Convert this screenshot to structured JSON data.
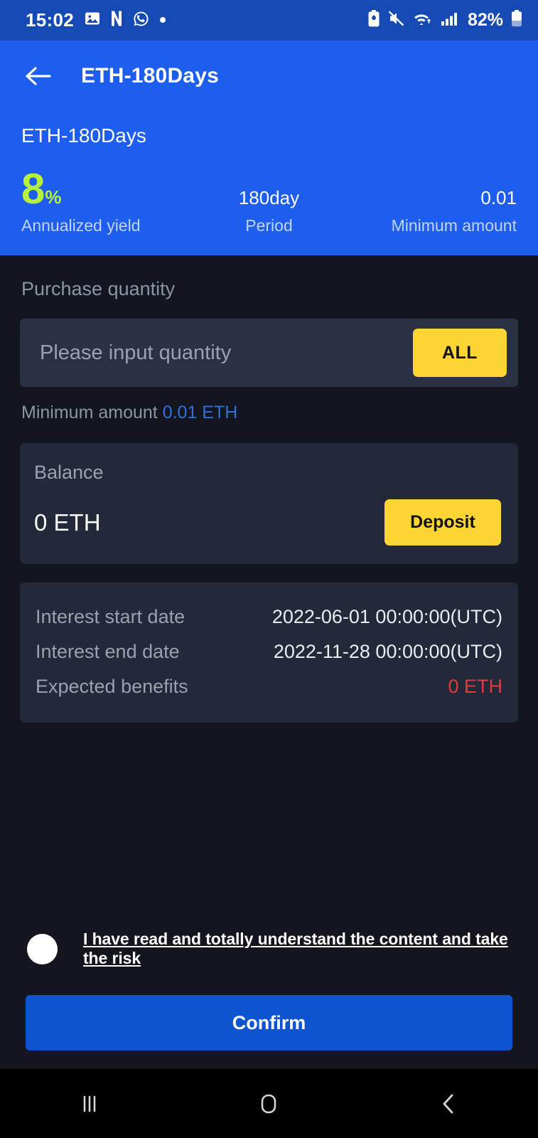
{
  "status_bar": {
    "time": "15:02",
    "battery_percent": "82%",
    "left_icons": [
      "photo-icon",
      "netflix-icon",
      "whatsapp-icon",
      "dot-icon"
    ],
    "right_icons": [
      "battery-saver-icon",
      "mute-icon",
      "wifi-icon",
      "signal-icon"
    ],
    "background": "#1549b4"
  },
  "header": {
    "back_icon": "back-arrow-icon",
    "title": "ETH-180Days",
    "product_name": "ETH-180Days",
    "background": "#1d5eef",
    "stats": [
      {
        "value": "8",
        "suffix": "%",
        "label": "Annualized yield",
        "color": "#b4f13f"
      },
      {
        "value": "180day",
        "label": "Period"
      },
      {
        "value": "0.01",
        "label": "Minimum amount"
      }
    ]
  },
  "purchase": {
    "section_title": "Purchase quantity",
    "input_placeholder": "Please input quantity",
    "input_value": "",
    "all_button": "ALL",
    "min_label": "Minimum amount",
    "min_amount": "0.01 ETH",
    "min_amount_color": "#2f6fe0"
  },
  "balance": {
    "label": "Balance",
    "value": "0 ETH",
    "deposit_button": "Deposit",
    "button_color": "#fcd535"
  },
  "info": {
    "rows": [
      {
        "key": "Interest start date",
        "value": "2022-06-01 00:00:00(UTC)",
        "color": "#e9ecf2"
      },
      {
        "key": "Interest end date",
        "value": "2022-11-28 00:00:00(UTC)",
        "color": "#e9ecf2"
      },
      {
        "key": "Expected benefits",
        "value": "0 ETH",
        "color": "#e03b3b"
      }
    ]
  },
  "footer": {
    "agreement_text": "I have read and totally understand the content and take the risk",
    "checkbox_checked": true,
    "confirm_button": "Confirm",
    "confirm_color": "#0d55d0"
  },
  "system_nav": {
    "recents_icon": "recents-icon",
    "home_icon": "home-icon",
    "back_icon": "back-chevron-icon"
  }
}
